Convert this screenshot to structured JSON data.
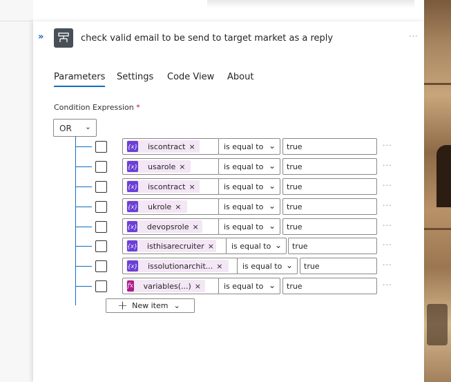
{
  "header": {
    "title": "check valid email to be send to target market as a reply",
    "expand_icon": "double-chevron-right-icon",
    "action_icon": "condition-icon",
    "more_label": "···"
  },
  "tabs": [
    {
      "label": "Parameters",
      "active": true
    },
    {
      "label": "Settings",
      "active": false
    },
    {
      "label": "Code View",
      "active": false
    },
    {
      "label": "About",
      "active": false
    }
  ],
  "condition": {
    "label": "Condition Expression",
    "required_mark": "*",
    "operator": "OR",
    "rows": [
      {
        "token": "iscontract",
        "token_icon": "{x}",
        "operator": "is equal to",
        "value": "true"
      },
      {
        "token": "usarole",
        "token_icon": "{x}",
        "operator": "is equal to",
        "value": "true"
      },
      {
        "token": "iscontract",
        "token_icon": "{x}",
        "operator": "is equal to",
        "value": "true"
      },
      {
        "token": "ukrole",
        "token_icon": "{x}",
        "operator": "is equal to",
        "value": "true"
      },
      {
        "token": "devopsrole",
        "token_icon": "{x}",
        "operator": "is equal to",
        "value": "true"
      },
      {
        "token": "isthisarecruiter",
        "token_icon": "{x}",
        "operator": "is equal to",
        "value": "true"
      },
      {
        "token": "issolutionarchit...",
        "token_icon": "{x}",
        "operator": "is equal to",
        "value": "true"
      },
      {
        "token": "variables(...)",
        "token_icon": "fx",
        "operator": "is equal to",
        "value": "true"
      }
    ],
    "remove_label": "×",
    "row_more_label": "···",
    "new_item_label": "New item",
    "new_item_plus": "+"
  },
  "colors": {
    "accent": "#0f6cbd",
    "token_bg": "#f3e6f5",
    "variable_icon": "#6b3fd6",
    "expression_icon": "#ad1a8a"
  }
}
